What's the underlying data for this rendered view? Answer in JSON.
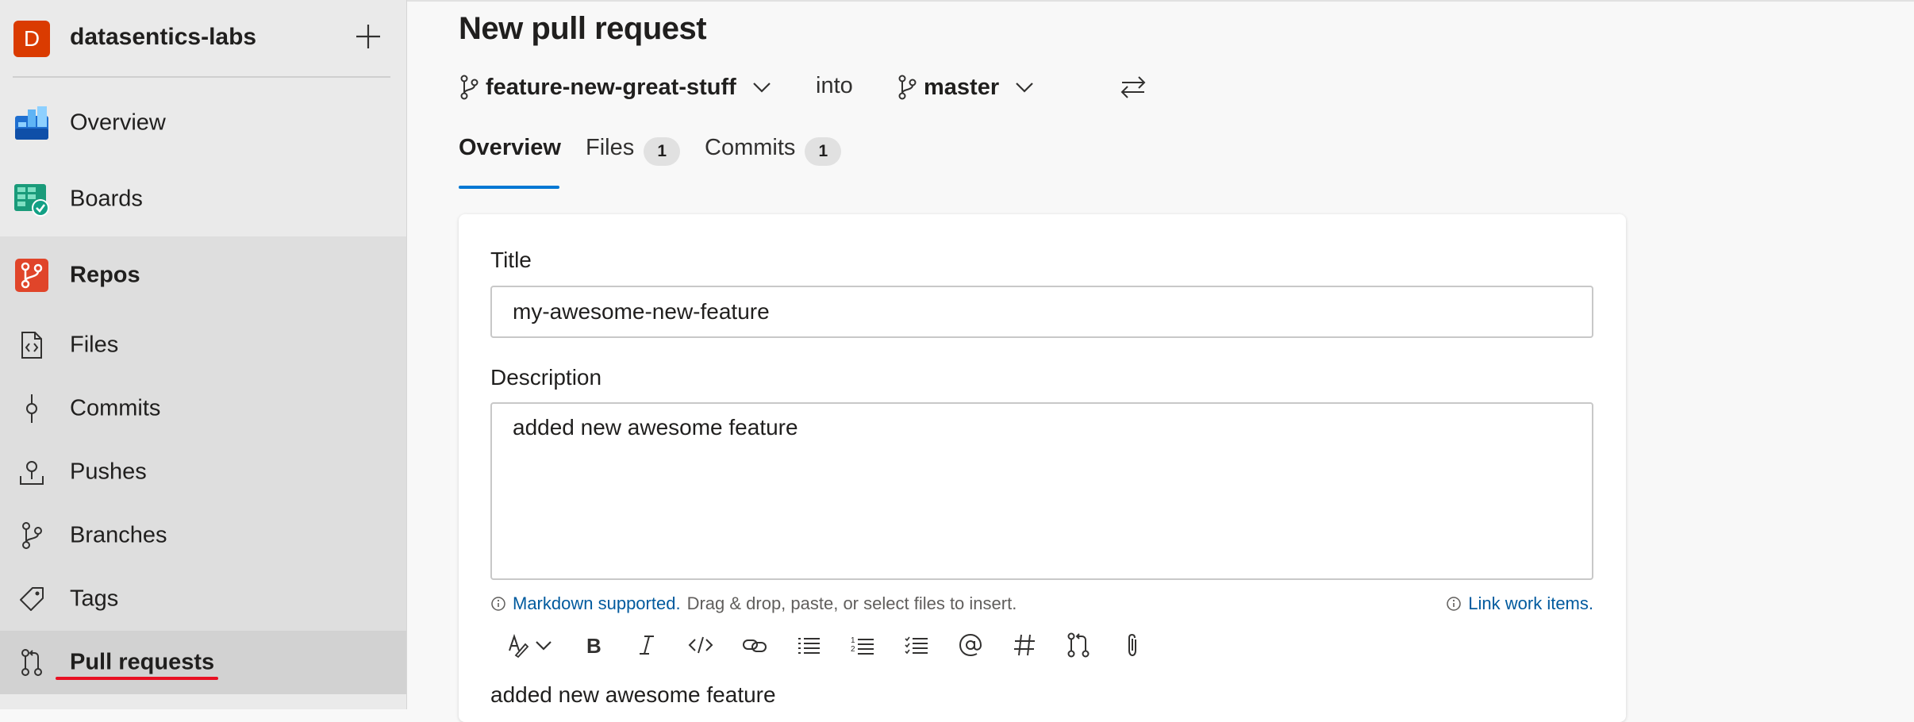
{
  "org": {
    "initial": "D",
    "name": "datasentics-labs"
  },
  "nav": {
    "overview": "Overview",
    "boards": "Boards",
    "repos": "Repos",
    "files": "Files",
    "commits": "Commits",
    "pushes": "Pushes",
    "branches": "Branches",
    "tags": "Tags",
    "pull_requests": "Pull requests"
  },
  "page": {
    "title": "New pull request"
  },
  "branches": {
    "source": "feature-new-great-stuff",
    "into_label": "into",
    "target": "master"
  },
  "tabs": [
    {
      "label": "Overview"
    },
    {
      "label": "Files",
      "count": "1"
    },
    {
      "label": "Commits",
      "count": "1"
    }
  ],
  "form": {
    "title_label": "Title",
    "title_value": "my-awesome-new-feature",
    "description_label": "Description",
    "description_value": "added new awesome feature",
    "markdown_link": "Markdown supported.",
    "markdown_hint": "Drag & drop, paste, or select files to insert.",
    "work_items_link": "Link work items.",
    "preview": "added new awesome feature"
  },
  "colors": {
    "accent": "#0078d4",
    "org_badge": "#da3b01",
    "selected_underline": "#e81123",
    "link": "#005a9e"
  }
}
